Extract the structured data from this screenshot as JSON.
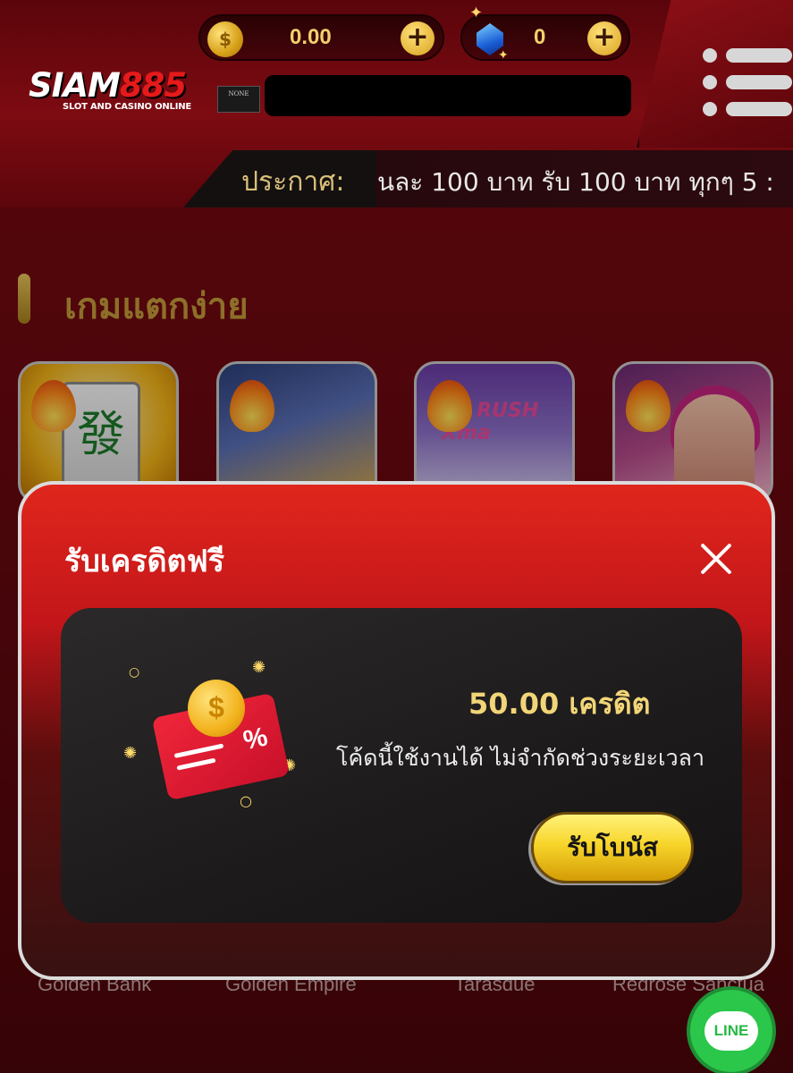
{
  "brand": {
    "logo_main": "SIAM",
    "logo_num": "885",
    "logo_sub": "SLOT AND CASINO ONLINE"
  },
  "wallet": {
    "coin_balance": "0.00",
    "gem_balance": "0",
    "coin_symbol": "$",
    "plus": "+"
  },
  "level_badge": "NONE",
  "announcement": {
    "label": "ประกาศ:",
    "text": "นละ 100 บาท รับ 100 บาท ทุกๆ 5 :"
  },
  "section": {
    "title": "เกมแตกง่าย"
  },
  "games": [
    {
      "label": "Golden Bank",
      "tile_glyph": "發"
    },
    {
      "label": "Golden Empire"
    },
    {
      "label": "Tarasdue",
      "art_text": "Su  RUSH Xma"
    },
    {
      "label": "Redrose Sanctua"
    }
  ],
  "modal": {
    "title": "รับเครดิตฟรี",
    "amount": "50.00 เครดิต",
    "description": "โค้ดนี้ใช้งานได้ ไม่จำกัดช่วงระยะเวลา",
    "claim_label": "รับโบนัส",
    "voucher_symbol": "%",
    "coin_symbol": "$"
  },
  "line_button": {
    "label": "LINE"
  },
  "colors": {
    "brand_red": "#e61a1a",
    "gold": "#f1d577",
    "line_green": "#2bc74a"
  }
}
